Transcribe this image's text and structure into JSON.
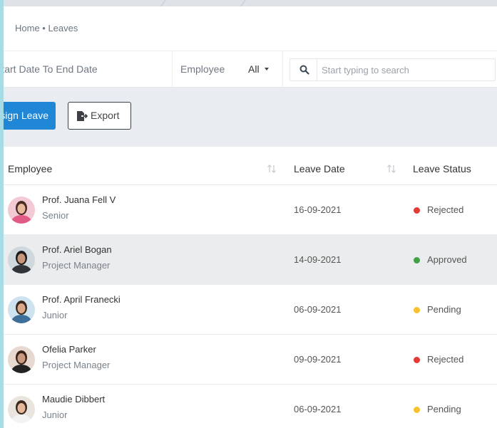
{
  "breadcrumb": "Home • Leaves",
  "filters": {
    "date_range": "Start Date To End Date",
    "employee_label": "Employee",
    "employee_value": "All",
    "search_placeholder": "Start typing to search"
  },
  "actions": {
    "assign_label": "Assign Leave",
    "export_label": "Export"
  },
  "table": {
    "columns": [
      "Employee",
      "Leave Date",
      "Leave Status"
    ],
    "rows": [
      {
        "name": "Prof. Juana Fell V",
        "role": "Senior",
        "date": "16-09-2021",
        "status": "Rejected",
        "status_color": "#e53935",
        "avatar_bg": "#f3c9d4",
        "avatar_shirt": "#e15b85",
        "avatar_hair": "#4a2a24",
        "avatar_skin": "#e8b99b"
      },
      {
        "name": "Prof. Ariel Bogan",
        "role": "Project Manager",
        "date": "14-09-2021",
        "status": "Approved",
        "status_color": "#43a047",
        "avatar_bg": "#cfd8dc",
        "avatar_shirt": "#2f3438",
        "avatar_hair": "#1c1c1c",
        "avatar_skin": "#c8977a"
      },
      {
        "name": "Prof. April Franecki",
        "role": "Junior",
        "date": "06-09-2021",
        "status": "Pending",
        "status_color": "#fbc02d",
        "avatar_bg": "#cfe3ef",
        "avatar_shirt": "#3d6f98",
        "avatar_hair": "#3b2a20",
        "avatar_skin": "#d9a98a"
      },
      {
        "name": "Ofelia Parker",
        "role": "Project Manager",
        "date": "09-09-2021",
        "status": "Rejected",
        "status_color": "#e53935",
        "avatar_bg": "#e7d8d0",
        "avatar_shirt": "#222222",
        "avatar_hair": "#3a221a",
        "avatar_skin": "#c99a80"
      },
      {
        "name": "Maudie Dibbert",
        "role": "Junior",
        "date": "06-09-2021",
        "status": "Pending",
        "status_color": "#fbc02d",
        "avatar_bg": "#e9e4de",
        "avatar_shirt": "#f3f3f3",
        "avatar_hair": "#3b2a20",
        "avatar_skin": "#e4b899"
      }
    ]
  }
}
